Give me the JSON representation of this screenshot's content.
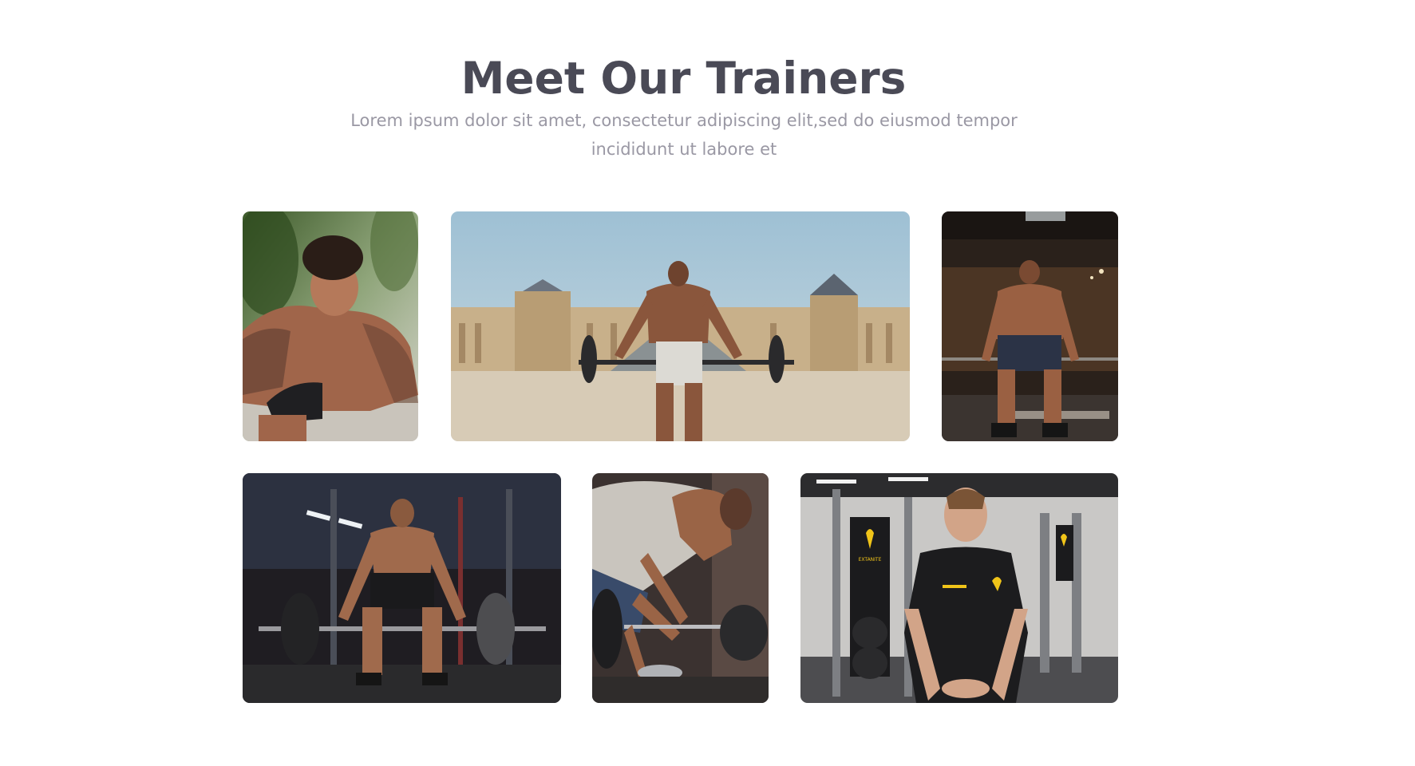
{
  "section": {
    "title": "Meet Our Trainers",
    "subtitle": "Lorem ipsum dolor sit amet, consectetur adipiscing elit,sed do eiusmod tempor incididunt ut labore et"
  },
  "trainers": [
    {
      "image": "trainer-pushup-photo"
    },
    {
      "image": "trainer-deadlift-louvre-photo"
    },
    {
      "image": "trainer-back-gym-photo"
    },
    {
      "image": "trainer-deadlift-rack-photo"
    },
    {
      "image": "trainer-barbell-closeup-photo"
    },
    {
      "image": "trainer-portrait-gym-photo"
    }
  ],
  "shirt_logo_text": "EXTANITE"
}
